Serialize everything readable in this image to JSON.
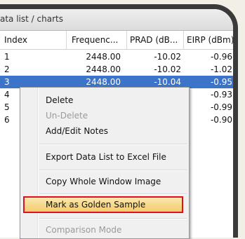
{
  "window": {
    "title": "ata list / charts"
  },
  "table": {
    "columns": [
      "Index",
      "Frequenc...",
      "PRAD (dB...",
      "EIRP (dBm)"
    ],
    "rows": [
      {
        "index": "1",
        "freq": "2448.00",
        "prad": "-10.02",
        "eirp": "-0.96",
        "selected": false
      },
      {
        "index": "2",
        "freq": "2448.00",
        "prad": "-10.02",
        "eirp": "-1.02",
        "selected": false
      },
      {
        "index": "3",
        "freq": "2448.00",
        "prad": "-10.04",
        "eirp": "-0.95",
        "selected": true
      },
      {
        "index": "4",
        "freq": "",
        "prad": "",
        "eirp": "-0.93",
        "selected": false
      },
      {
        "index": "5",
        "freq": "",
        "prad": "",
        "eirp": "-0.99",
        "selected": false
      },
      {
        "index": "6",
        "freq": "",
        "prad": "",
        "eirp": "-0.90",
        "selected": false
      }
    ]
  },
  "context_menu": {
    "items": [
      {
        "label": "Delete",
        "enabled": true
      },
      {
        "label": "Un-Delete",
        "enabled": false
      },
      {
        "label": "Add/Edit Notes",
        "enabled": true
      },
      {
        "label": "Export Data List to Excel File",
        "enabled": true
      },
      {
        "label": "Copy Whole Window Image",
        "enabled": true
      },
      {
        "label": "Mark as Golden Sample",
        "enabled": true,
        "highlighted": true
      },
      {
        "label": "Comparison Mode",
        "enabled": false
      }
    ]
  },
  "colors": {
    "selection": "#3b74c8",
    "highlight_border": "#e01020",
    "highlight_fill": "#f3cc6c",
    "frame": "#3a3a3a"
  }
}
